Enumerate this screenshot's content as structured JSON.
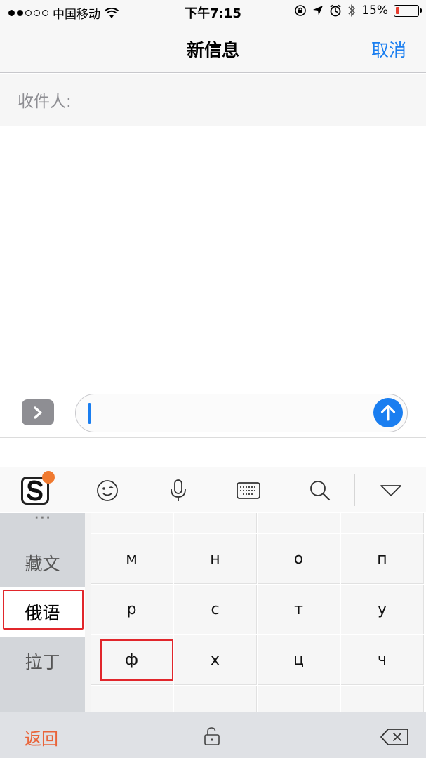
{
  "status_bar": {
    "carrier": "中国移动",
    "time": "下午7:15",
    "battery_percent": "15%",
    "battery_level": 0.15,
    "battery_color": "#e53c2e"
  },
  "nav": {
    "title": "新信息",
    "cancel_label": "取消"
  },
  "recipient": {
    "label": "收件人:"
  },
  "compose": {
    "input_value": ""
  },
  "toolbar": {
    "icons": [
      "sogou-logo-icon",
      "emoji-icon",
      "microphone-icon",
      "keyboard-icon",
      "search-icon",
      "collapse-keyboard-icon"
    ]
  },
  "keyboard": {
    "languages": [
      {
        "label": "藏文",
        "selected": false
      },
      {
        "label": "俄语",
        "selected": true
      },
      {
        "label": "拉丁",
        "selected": false
      }
    ],
    "key_rows": [
      [
        "м",
        "н",
        "о",
        "п"
      ],
      [
        "р",
        "с",
        "т",
        "у"
      ],
      [
        "ф",
        "х",
        "ц",
        "ч"
      ]
    ],
    "highlighted_key": "ф"
  },
  "bottom": {
    "back_label": "返回"
  },
  "colors": {
    "accent": "#1a7ef0",
    "highlight_border": "#e1262b",
    "back_text": "#e9643a"
  }
}
